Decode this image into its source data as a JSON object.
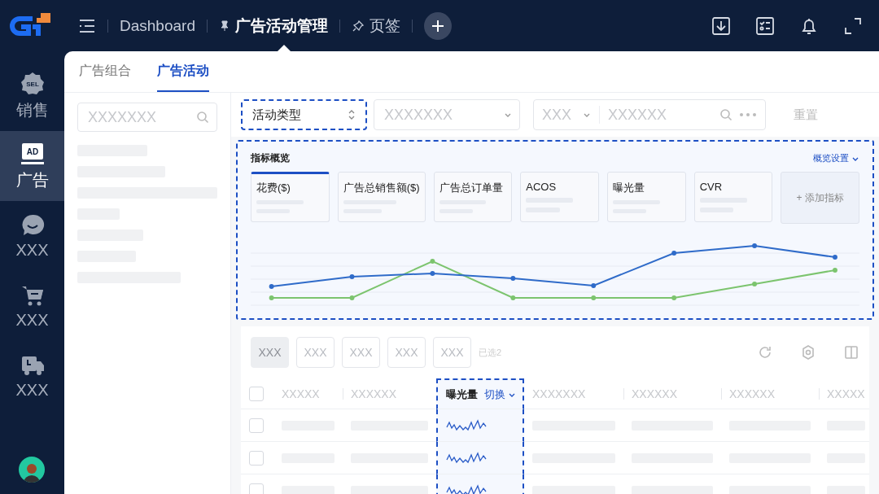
{
  "top_bar": {
    "tabs": [
      {
        "label": "Dashboard",
        "selected": false,
        "kind": "plain"
      },
      {
        "label": "广告活动管理",
        "selected": true,
        "kind": "pinned"
      },
      {
        "label": "页签",
        "selected": false,
        "kind": "unpinned"
      }
    ]
  },
  "sidebar": {
    "items": [
      {
        "label": "销售",
        "kind": "badge",
        "icon_text": "SEL",
        "selected": false
      },
      {
        "label": "广告",
        "kind": "ad",
        "icon_text": "AD",
        "selected": true
      },
      {
        "label": "XXX",
        "kind": "chat",
        "selected": false
      },
      {
        "label": "XXX",
        "kind": "cart",
        "selected": false
      },
      {
        "label": "XXX",
        "kind": "truck",
        "selected": false
      }
    ]
  },
  "page_tabs": [
    {
      "label": "广告组合",
      "selected": false
    },
    {
      "label": "广告活动",
      "selected": true
    }
  ],
  "left_panel": {
    "search": {
      "placeholder": "XXXXXXX"
    }
  },
  "filters": {
    "type_select": {
      "value": "活动类型",
      "highlighted": true
    },
    "select": {
      "placeholder": "XXXXXXX"
    },
    "search_group": {
      "scope": "XXX",
      "placeholder": "XXXXXX"
    },
    "reset": "重置"
  },
  "overview": {
    "title": "指标概览",
    "settings": "概览设置",
    "highlighted": true,
    "metrics": [
      {
        "name": "花费($)",
        "selected": true
      },
      {
        "name": "广告总销售额($)",
        "selected": false
      },
      {
        "name": "广告总订单量",
        "selected": false
      },
      {
        "name": "ACOS",
        "selected": false
      },
      {
        "name": "曝光量",
        "selected": false
      },
      {
        "name": "CVR",
        "selected": false
      }
    ],
    "add_metric": "+ 添加指标"
  },
  "table": {
    "toolbar_buttons": [
      {
        "label": "XXX",
        "disabled": true
      },
      {
        "label": "XXX",
        "disabled": false
      },
      {
        "label": "XXX",
        "disabled": false
      },
      {
        "label": "XXX",
        "disabled": false
      },
      {
        "label": "XXX",
        "disabled": false
      }
    ],
    "selected_count": "已选2",
    "header_checked": false,
    "columns": [
      {
        "label": "XXXXX",
        "kind": "plain"
      },
      {
        "label": "XXXXXX",
        "kind": "plain"
      },
      {
        "label": "曝光量",
        "kind": "trend",
        "switch": "切换",
        "highlighted": true
      },
      {
        "label": "XXXXXXX",
        "kind": "plain"
      },
      {
        "label": "XXXXXX",
        "kind": "plain"
      },
      {
        "label": "XXXXXX",
        "kind": "plain"
      },
      {
        "label": "XXXXX",
        "kind": "plain"
      }
    ],
    "rows": [
      {
        "checked": false
      },
      {
        "checked": false
      },
      {
        "checked": false
      }
    ]
  }
}
